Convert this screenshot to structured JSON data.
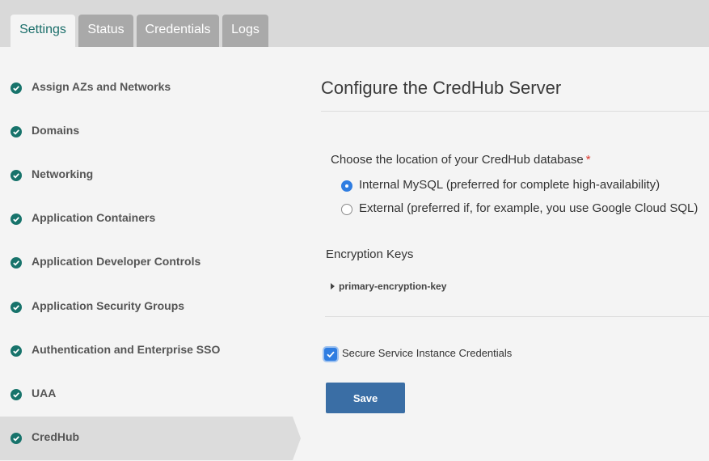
{
  "tabs": [
    {
      "label": "Settings",
      "active": true
    },
    {
      "label": "Status",
      "active": false
    },
    {
      "label": "Credentials",
      "active": false
    },
    {
      "label": "Logs",
      "active": false
    }
  ],
  "sidebar": {
    "items": [
      {
        "label": "Assign AZs and Networks",
        "icon": "check-circle-icon",
        "status": "complete"
      },
      {
        "label": "Domains",
        "icon": "check-circle-icon",
        "status": "complete"
      },
      {
        "label": "Networking",
        "icon": "check-circle-icon",
        "status": "complete"
      },
      {
        "label": "Application Containers",
        "icon": "check-circle-icon",
        "status": "complete"
      },
      {
        "label": "Application Developer Controls",
        "icon": "check-circle-icon",
        "status": "complete"
      },
      {
        "label": "Application Security Groups",
        "icon": "check-circle-icon",
        "status": "complete"
      },
      {
        "label": "Authentication and Enterprise SSO",
        "icon": "check-circle-icon",
        "status": "complete"
      },
      {
        "label": "UAA",
        "icon": "check-circle-icon",
        "status": "complete"
      },
      {
        "label": "CredHub",
        "icon": "check-circle-icon",
        "status": "complete",
        "active": true
      }
    ]
  },
  "main": {
    "title": "Configure the CredHub Server",
    "database": {
      "question": "Choose the location of your CredHub database",
      "required_mark": "*",
      "options": [
        {
          "label": "Internal MySQL (preferred for complete high-availability)",
          "selected": true
        },
        {
          "label": "External (preferred if, for example, you use Google Cloud SQL)",
          "selected": false
        }
      ]
    },
    "encryption": {
      "heading": "Encryption Keys",
      "key_label": "primary-encryption-key"
    },
    "secure_credentials": {
      "label": "Secure Service Instance Credentials",
      "checked": true
    },
    "save_label": "Save"
  },
  "colors": {
    "accent_teal": "#17736b",
    "save_button": "#3a6ea5",
    "selected_blue": "#2f7de1",
    "required_red": "#d9362b"
  }
}
